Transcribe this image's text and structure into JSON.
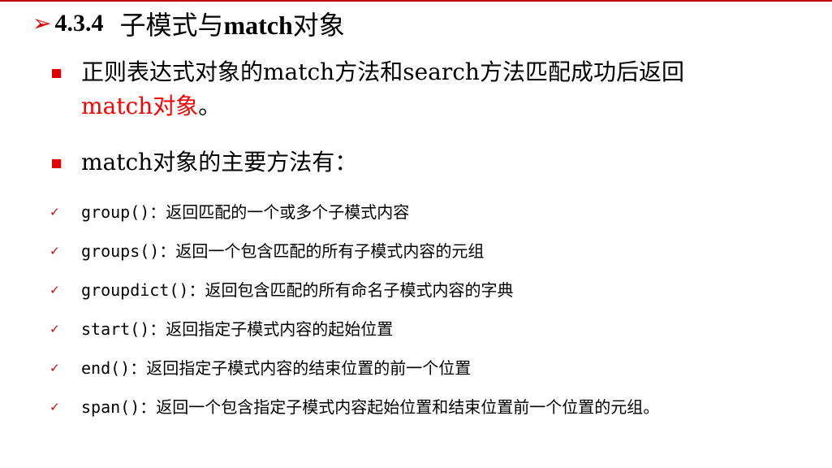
{
  "title": {
    "arrow": "➢",
    "number": "4.3.4",
    "text_pre": "子模式与",
    "text_bold": "match",
    "text_post": "对象"
  },
  "bullets": [
    {
      "line1": "正则表达式对象的match方法和search方法匹配成功后返回",
      "line2_highlight": "match对象",
      "line2_tail": "。"
    },
    {
      "text": "match对象的主要方法有："
    }
  ],
  "methods": [
    {
      "name": "group()",
      "desc": "：返回匹配的一个或多个子模式内容"
    },
    {
      "name": "groups()",
      "desc": "：返回一个包含匹配的所有子模式内容的元组"
    },
    {
      "name": "groupdict()",
      "desc": "：返回包含匹配的所有命名子模式内容的字典"
    },
    {
      "name": "start()",
      "desc": "：返回指定子模式内容的起始位置"
    },
    {
      "name": "end()",
      "desc": "：返回指定子模式内容的结束位置的前一个位置"
    },
    {
      "name": "span()",
      "desc": "：返回一个包含指定子模式内容起始位置和结束位置前一个位置的元组。"
    }
  ],
  "check_glyph": "✓",
  "colors": {
    "accent": "#e00000",
    "highlight": "#ff0000",
    "top_rule": "#c00000"
  }
}
